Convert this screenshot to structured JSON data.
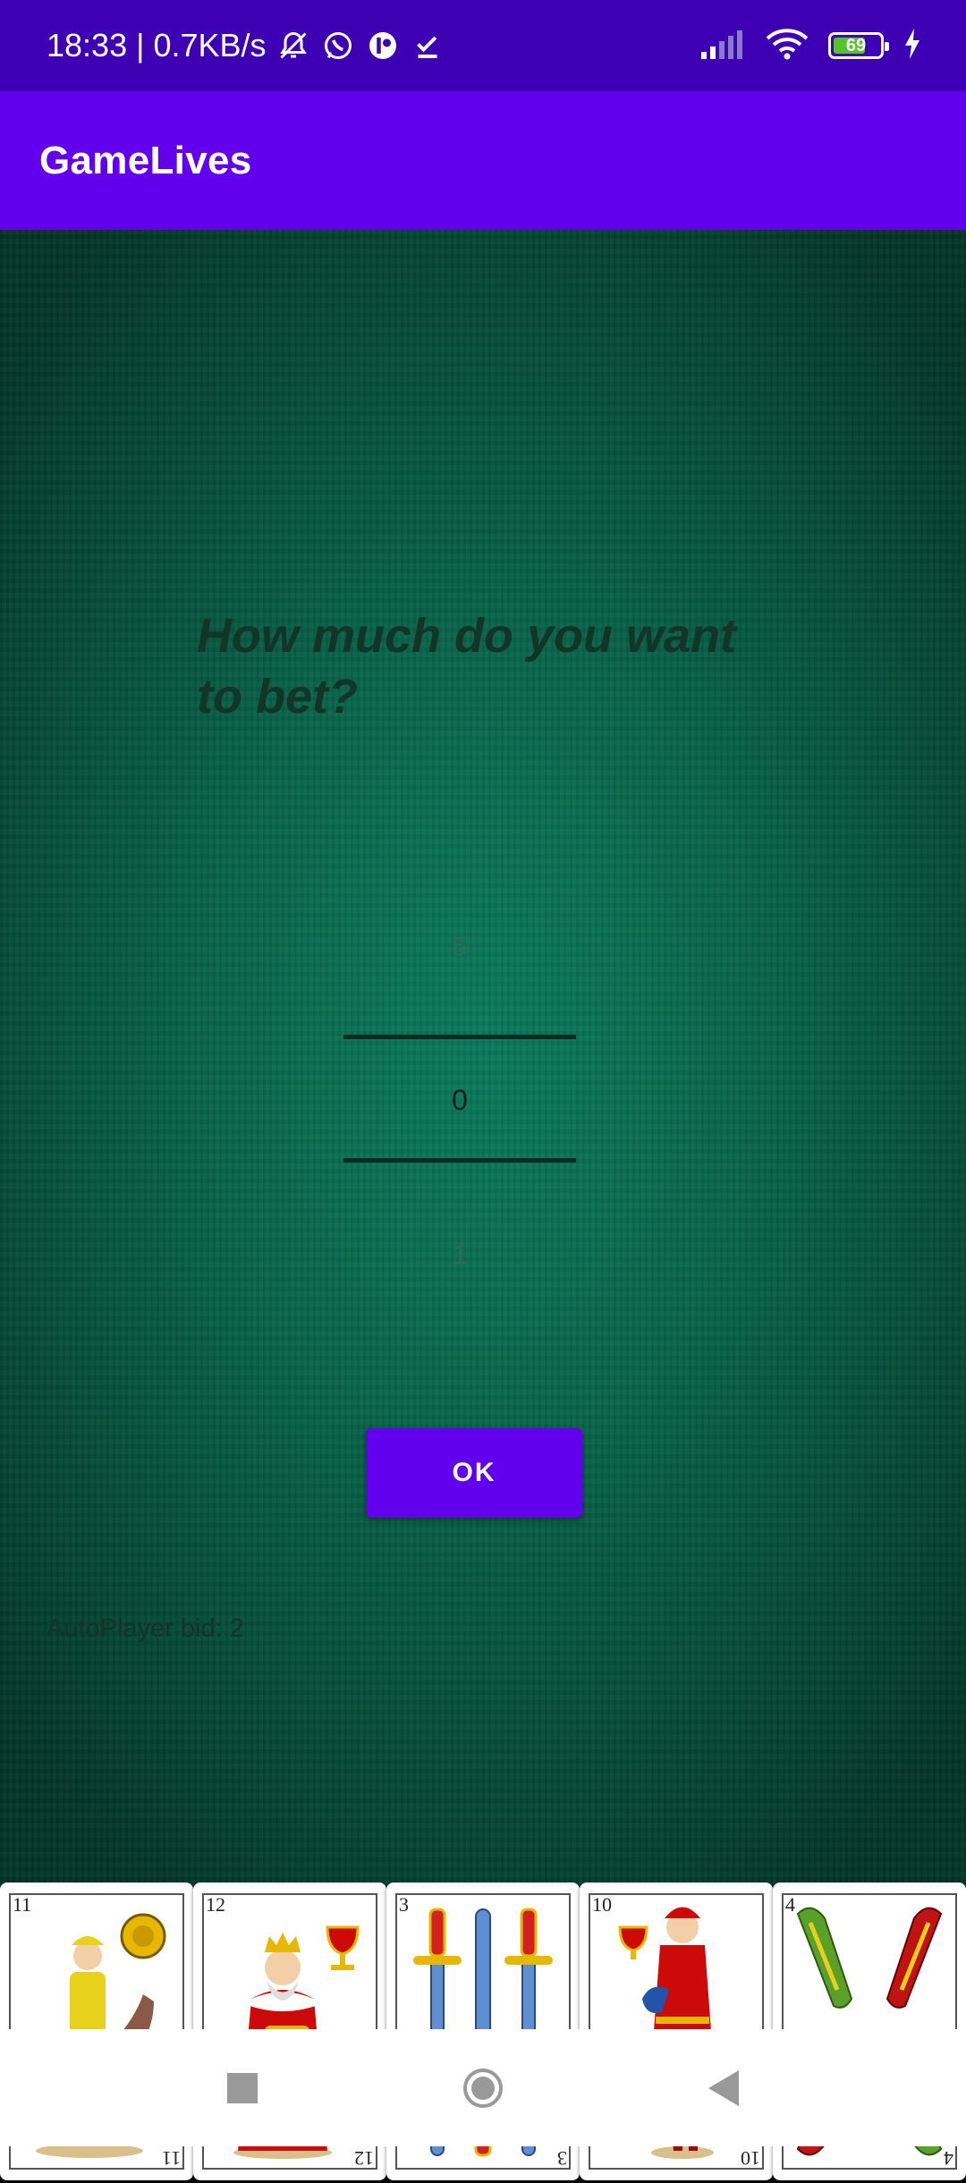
{
  "status_bar": {
    "time_speed": "18:33 | 0.7KB/s",
    "battery_level": "69",
    "icons": [
      "bell-off-icon",
      "whatsapp-icon",
      "app-icon",
      "download-done-icon",
      "signal-icon",
      "wifi-icon",
      "battery-icon",
      "charging-icon"
    ]
  },
  "app_bar": {
    "title": "GameLives"
  },
  "prompt": {
    "question": "How much do you want to bet?"
  },
  "bet_picker": {
    "previous": "5",
    "current": "0",
    "next": "1"
  },
  "ok_button": {
    "label": "OK"
  },
  "bid_info": {
    "text": "AutoPlayer bid: 2"
  },
  "hand": {
    "cards": [
      {
        "rank": "11",
        "suit": "oros"
      },
      {
        "rank": "12",
        "suit": "copas"
      },
      {
        "rank": "3",
        "suit": "espadas"
      },
      {
        "rank": "10",
        "suit": "copas"
      },
      {
        "rank": "4",
        "suit": "bastos"
      }
    ]
  },
  "colors": {
    "status_bar": "#3d00b3",
    "primary": "#6200ee",
    "felt": "#08654a"
  }
}
